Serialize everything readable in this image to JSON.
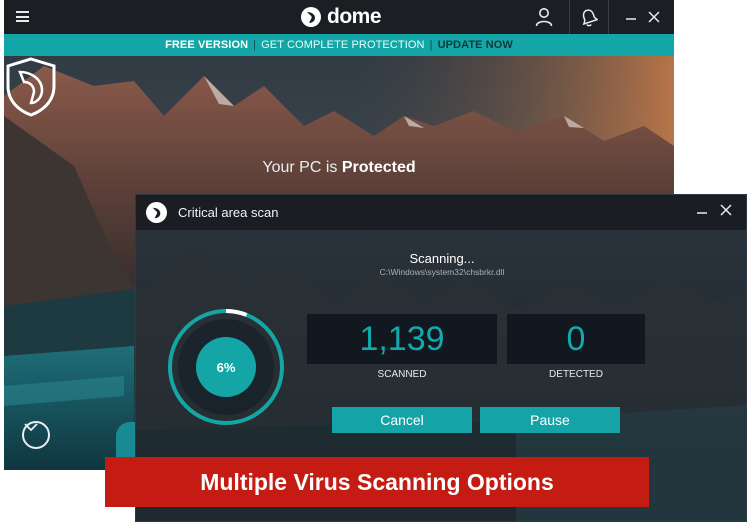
{
  "app": {
    "brand": "dome",
    "promo": {
      "free_version": "FREE VERSION",
      "get_complete": "GET COMPLETE PROTECTION",
      "update_now": "UPDATE NOW"
    },
    "status": {
      "prefix": "Your PC is ",
      "state": "Protected"
    },
    "icons": {
      "menu": "hamburger-icon",
      "user": "user-icon",
      "notifications": "bell-icon",
      "minimize": "minimize-icon",
      "close": "close-icon",
      "shield": "shield-icon",
      "down": "chevron-down-icon"
    }
  },
  "scan_dialog": {
    "title": "Critical area scan",
    "status": "Scanning...",
    "current_file": "C:\\Windows\\system32\\chsbrkr.dll",
    "progress_label": "6%",
    "progress": 0.06,
    "scanned": {
      "value": "1,139",
      "label": "SCANNED"
    },
    "detected": {
      "value": "0",
      "label": "DETECTED"
    },
    "cancel_label": "Cancel",
    "pause_label": "Pause"
  },
  "caption": "Multiple Virus Scanning Options",
  "colors": {
    "accent": "#14a6a6",
    "caption_bg": "#c41b13",
    "titlebar": "#1b1f24"
  }
}
